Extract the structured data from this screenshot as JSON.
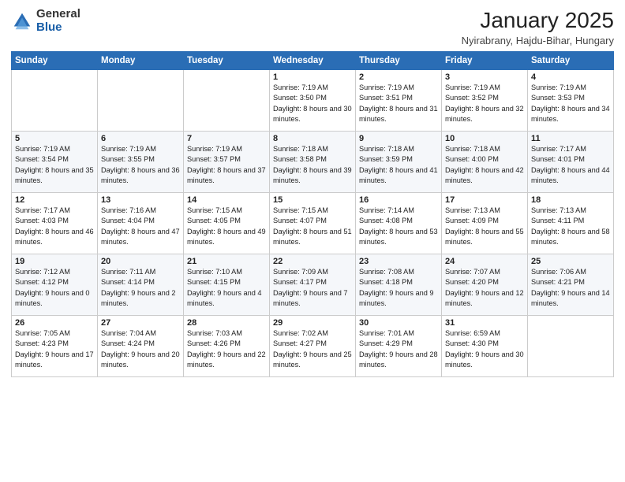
{
  "logo": {
    "general": "General",
    "blue": "Blue"
  },
  "header": {
    "month": "January 2025",
    "location": "Nyirabrany, Hajdu-Bihar, Hungary"
  },
  "weekdays": [
    "Sunday",
    "Monday",
    "Tuesday",
    "Wednesday",
    "Thursday",
    "Friday",
    "Saturday"
  ],
  "weeks": [
    [
      {
        "day": "",
        "sunrise": "",
        "sunset": "",
        "daylight": ""
      },
      {
        "day": "",
        "sunrise": "",
        "sunset": "",
        "daylight": ""
      },
      {
        "day": "",
        "sunrise": "",
        "sunset": "",
        "daylight": ""
      },
      {
        "day": "1",
        "sunrise": "Sunrise: 7:19 AM",
        "sunset": "Sunset: 3:50 PM",
        "daylight": "Daylight: 8 hours and 30 minutes."
      },
      {
        "day": "2",
        "sunrise": "Sunrise: 7:19 AM",
        "sunset": "Sunset: 3:51 PM",
        "daylight": "Daylight: 8 hours and 31 minutes."
      },
      {
        "day": "3",
        "sunrise": "Sunrise: 7:19 AM",
        "sunset": "Sunset: 3:52 PM",
        "daylight": "Daylight: 8 hours and 32 minutes."
      },
      {
        "day": "4",
        "sunrise": "Sunrise: 7:19 AM",
        "sunset": "Sunset: 3:53 PM",
        "daylight": "Daylight: 8 hours and 34 minutes."
      }
    ],
    [
      {
        "day": "5",
        "sunrise": "Sunrise: 7:19 AM",
        "sunset": "Sunset: 3:54 PM",
        "daylight": "Daylight: 8 hours and 35 minutes."
      },
      {
        "day": "6",
        "sunrise": "Sunrise: 7:19 AM",
        "sunset": "Sunset: 3:55 PM",
        "daylight": "Daylight: 8 hours and 36 minutes."
      },
      {
        "day": "7",
        "sunrise": "Sunrise: 7:19 AM",
        "sunset": "Sunset: 3:57 PM",
        "daylight": "Daylight: 8 hours and 37 minutes."
      },
      {
        "day": "8",
        "sunrise": "Sunrise: 7:18 AM",
        "sunset": "Sunset: 3:58 PM",
        "daylight": "Daylight: 8 hours and 39 minutes."
      },
      {
        "day": "9",
        "sunrise": "Sunrise: 7:18 AM",
        "sunset": "Sunset: 3:59 PM",
        "daylight": "Daylight: 8 hours and 41 minutes."
      },
      {
        "day": "10",
        "sunrise": "Sunrise: 7:18 AM",
        "sunset": "Sunset: 4:00 PM",
        "daylight": "Daylight: 8 hours and 42 minutes."
      },
      {
        "day": "11",
        "sunrise": "Sunrise: 7:17 AM",
        "sunset": "Sunset: 4:01 PM",
        "daylight": "Daylight: 8 hours and 44 minutes."
      }
    ],
    [
      {
        "day": "12",
        "sunrise": "Sunrise: 7:17 AM",
        "sunset": "Sunset: 4:03 PM",
        "daylight": "Daylight: 8 hours and 46 minutes."
      },
      {
        "day": "13",
        "sunrise": "Sunrise: 7:16 AM",
        "sunset": "Sunset: 4:04 PM",
        "daylight": "Daylight: 8 hours and 47 minutes."
      },
      {
        "day": "14",
        "sunrise": "Sunrise: 7:15 AM",
        "sunset": "Sunset: 4:05 PM",
        "daylight": "Daylight: 8 hours and 49 minutes."
      },
      {
        "day": "15",
        "sunrise": "Sunrise: 7:15 AM",
        "sunset": "Sunset: 4:07 PM",
        "daylight": "Daylight: 8 hours and 51 minutes."
      },
      {
        "day": "16",
        "sunrise": "Sunrise: 7:14 AM",
        "sunset": "Sunset: 4:08 PM",
        "daylight": "Daylight: 8 hours and 53 minutes."
      },
      {
        "day": "17",
        "sunrise": "Sunrise: 7:13 AM",
        "sunset": "Sunset: 4:09 PM",
        "daylight": "Daylight: 8 hours and 55 minutes."
      },
      {
        "day": "18",
        "sunrise": "Sunrise: 7:13 AM",
        "sunset": "Sunset: 4:11 PM",
        "daylight": "Daylight: 8 hours and 58 minutes."
      }
    ],
    [
      {
        "day": "19",
        "sunrise": "Sunrise: 7:12 AM",
        "sunset": "Sunset: 4:12 PM",
        "daylight": "Daylight: 9 hours and 0 minutes."
      },
      {
        "day": "20",
        "sunrise": "Sunrise: 7:11 AM",
        "sunset": "Sunset: 4:14 PM",
        "daylight": "Daylight: 9 hours and 2 minutes."
      },
      {
        "day": "21",
        "sunrise": "Sunrise: 7:10 AM",
        "sunset": "Sunset: 4:15 PM",
        "daylight": "Daylight: 9 hours and 4 minutes."
      },
      {
        "day": "22",
        "sunrise": "Sunrise: 7:09 AM",
        "sunset": "Sunset: 4:17 PM",
        "daylight": "Daylight: 9 hours and 7 minutes."
      },
      {
        "day": "23",
        "sunrise": "Sunrise: 7:08 AM",
        "sunset": "Sunset: 4:18 PM",
        "daylight": "Daylight: 9 hours and 9 minutes."
      },
      {
        "day": "24",
        "sunrise": "Sunrise: 7:07 AM",
        "sunset": "Sunset: 4:20 PM",
        "daylight": "Daylight: 9 hours and 12 minutes."
      },
      {
        "day": "25",
        "sunrise": "Sunrise: 7:06 AM",
        "sunset": "Sunset: 4:21 PM",
        "daylight": "Daylight: 9 hours and 14 minutes."
      }
    ],
    [
      {
        "day": "26",
        "sunrise": "Sunrise: 7:05 AM",
        "sunset": "Sunset: 4:23 PM",
        "daylight": "Daylight: 9 hours and 17 minutes."
      },
      {
        "day": "27",
        "sunrise": "Sunrise: 7:04 AM",
        "sunset": "Sunset: 4:24 PM",
        "daylight": "Daylight: 9 hours and 20 minutes."
      },
      {
        "day": "28",
        "sunrise": "Sunrise: 7:03 AM",
        "sunset": "Sunset: 4:26 PM",
        "daylight": "Daylight: 9 hours and 22 minutes."
      },
      {
        "day": "29",
        "sunrise": "Sunrise: 7:02 AM",
        "sunset": "Sunset: 4:27 PM",
        "daylight": "Daylight: 9 hours and 25 minutes."
      },
      {
        "day": "30",
        "sunrise": "Sunrise: 7:01 AM",
        "sunset": "Sunset: 4:29 PM",
        "daylight": "Daylight: 9 hours and 28 minutes."
      },
      {
        "day": "31",
        "sunrise": "Sunrise: 6:59 AM",
        "sunset": "Sunset: 4:30 PM",
        "daylight": "Daylight: 9 hours and 30 minutes."
      },
      {
        "day": "",
        "sunrise": "",
        "sunset": "",
        "daylight": ""
      }
    ]
  ]
}
